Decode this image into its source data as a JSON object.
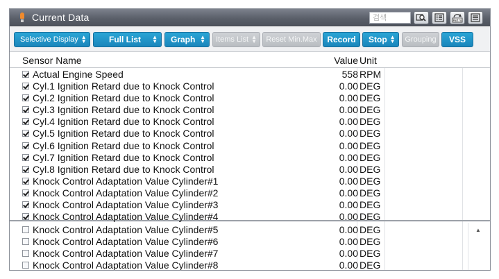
{
  "window": {
    "title": "Current Data",
    "search_placeholder": "검색"
  },
  "title_buttons": [
    {
      "name": "search-zoom-icon"
    },
    {
      "name": "list-icon"
    },
    {
      "name": "retry-icon",
      "label": "Retry"
    },
    {
      "name": "menu-icon"
    }
  ],
  "toolbar": {
    "selective_display": "Selective Display",
    "full_list": "Full List",
    "graph": "Graph",
    "items_list": "Items List",
    "reset_min_max": "Reset Min.Max",
    "record": "Record",
    "stop": "Stop",
    "grouping": "Grouping",
    "vss": "VSS"
  },
  "table": {
    "headers": {
      "name": "Sensor Name",
      "value": "Value",
      "unit": "Unit"
    },
    "rows_top": [
      {
        "name": "Actual Engine Speed",
        "value": "558",
        "unit": "RPM",
        "checked": true
      },
      {
        "name": "Cyl.1 Ignition Retard due to Knock Control",
        "value": "0.00",
        "unit": "DEG",
        "checked": true
      },
      {
        "name": "Cyl.2 Ignition Retard due to Knock Control",
        "value": "0.00",
        "unit": "DEG",
        "checked": true
      },
      {
        "name": "Cyl.3 Ignition Retard due to Knock Control",
        "value": "0.00",
        "unit": "DEG",
        "checked": true
      },
      {
        "name": "Cyl.4 Ignition Retard due to Knock Control",
        "value": "0.00",
        "unit": "DEG",
        "checked": true
      },
      {
        "name": "Cyl.5 Ignition Retard due to Knock Control",
        "value": "0.00",
        "unit": "DEG",
        "checked": true
      },
      {
        "name": "Cyl.6 Ignition Retard due to Knock Control",
        "value": "0.00",
        "unit": "DEG",
        "checked": true
      },
      {
        "name": "Cyl.7 Ignition Retard due to Knock Control",
        "value": "0.00",
        "unit": "DEG",
        "checked": true
      },
      {
        "name": "Cyl.8 Ignition Retard due to Knock Control",
        "value": "0.00",
        "unit": "DEG",
        "checked": true
      },
      {
        "name": "Knock Control Adaptation Value Cylinder#1",
        "value": "0.00",
        "unit": "DEG",
        "checked": true
      },
      {
        "name": "Knock Control Adaptation Value Cylinder#2",
        "value": "0.00",
        "unit": "DEG",
        "checked": true
      },
      {
        "name": "Knock Control Adaptation Value Cylinder#3",
        "value": "0.00",
        "unit": "DEG",
        "checked": true
      },
      {
        "name": "Knock Control Adaptation Value Cylinder#4",
        "value": "0.00",
        "unit": "DEG",
        "checked": true
      }
    ],
    "rows_bottom": [
      {
        "name": "Knock Control Adaptation Value Cylinder#5",
        "value": "0.00",
        "unit": "DEG",
        "checked": false
      },
      {
        "name": "Knock Control Adaptation Value Cylinder#6",
        "value": "0.00",
        "unit": "DEG",
        "checked": false
      },
      {
        "name": "Knock Control Adaptation Value Cylinder#7",
        "value": "0.00",
        "unit": "DEG",
        "checked": false
      },
      {
        "name": "Knock Control Adaptation Value Cylinder#8",
        "value": "0.00",
        "unit": "DEG",
        "checked": false
      }
    ]
  },
  "colors": {
    "button_blue": "#1f95c9",
    "button_disabled": "#c3c6cb",
    "titlebar": "#5f646e"
  }
}
